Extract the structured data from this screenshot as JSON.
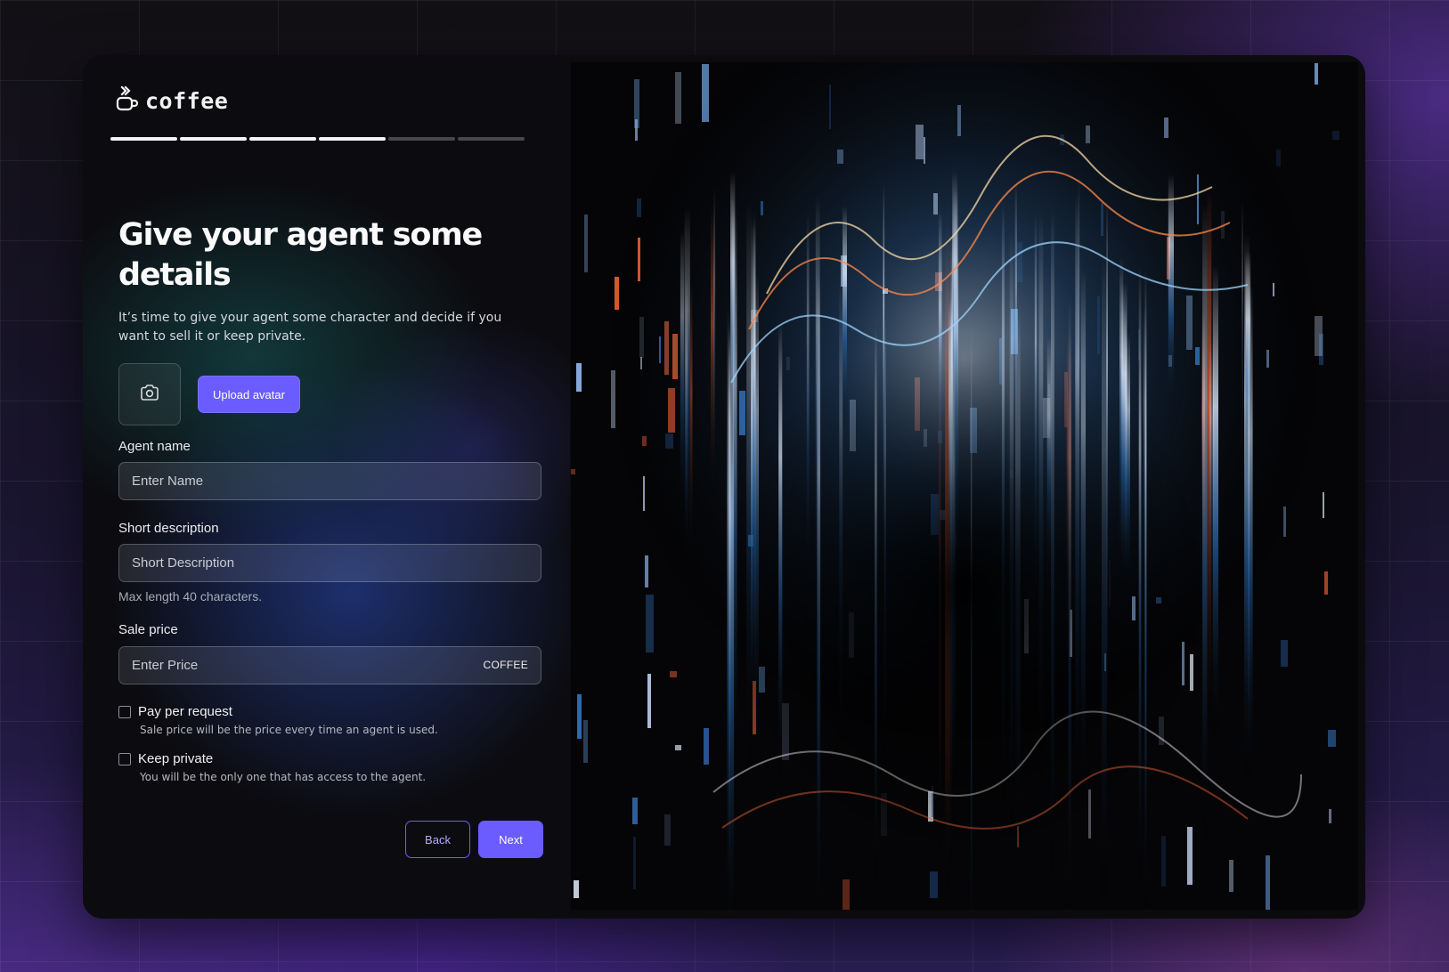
{
  "app": {
    "logo_text": "coffee",
    "logo_icon": "coffee-cup-icon"
  },
  "progress": {
    "total_steps": 6,
    "completed_steps": 4
  },
  "header": {
    "title": "Give your agent some details",
    "subtitle": "It’s time to give your agent some character and decide if you want to sell it or keep private."
  },
  "avatar": {
    "icon": "camera-icon",
    "upload_label": "Upload avatar"
  },
  "form": {
    "agent_name": {
      "label": "Agent name",
      "placeholder": "Enter Name",
      "value": ""
    },
    "short_description": {
      "label": "Short description",
      "placeholder": "Short Description",
      "value": "",
      "hint": "Max length 40 characters."
    },
    "sale_price": {
      "label": "Sale price",
      "placeholder": "Enter Price",
      "value": "",
      "suffix": "COFFEE"
    },
    "pay_per_request": {
      "label": "Pay per request",
      "description": "Sale price will be the price every time an agent is used.",
      "checked": false
    },
    "keep_private": {
      "label": "Keep private",
      "description": "You will be the only one that has access to the agent.",
      "checked": false
    }
  },
  "actions": {
    "back_label": "Back",
    "next_label": "Next"
  },
  "colors": {
    "accent": "#6b5cff",
    "card_bg": "#0b0b0e",
    "progress_done": "#f4f4f6",
    "progress_todo": "#48484c"
  }
}
